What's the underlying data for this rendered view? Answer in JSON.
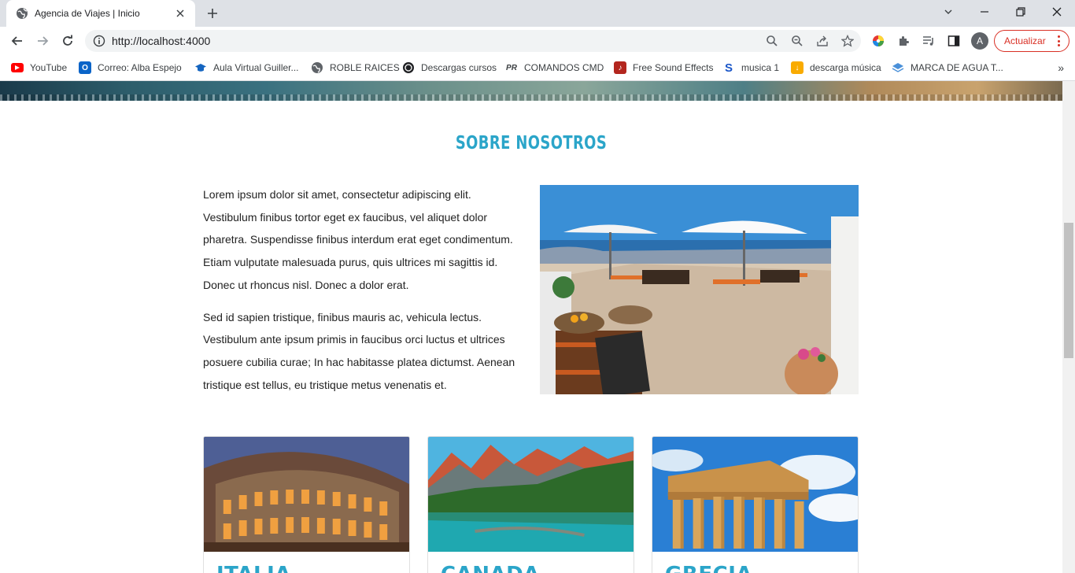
{
  "browser": {
    "tab_title": "Agencia de Viajes | Inicio",
    "url": "http://localhost:4000",
    "update_label": "Actualizar",
    "avatar_initial": "A",
    "bookmarks": [
      {
        "label": "YouTube",
        "icon": "youtube-icon",
        "color": "#ff0000"
      },
      {
        "label": "Correo: Alba Espejo",
        "icon": "outlook-icon",
        "color": "#0a64c8"
      },
      {
        "label": "Aula Virtual Guiller...",
        "icon": "graduation-cap-icon",
        "color": "#1565c0"
      },
      {
        "label": "ROBLE RAICES",
        "icon": "globe-icon",
        "color": "#5f6368"
      },
      {
        "label": "Descargas cursos",
        "icon": "download-circle-icon",
        "color": "#202124"
      },
      {
        "label": "COMANDOS CMD",
        "icon": "pr-icon",
        "color": "#3c4043"
      },
      {
        "label": "Free Sound Effects",
        "icon": "sound-icon",
        "color": "#b3261e"
      },
      {
        "label": "musica 1",
        "icon": "s-icon",
        "color": "#1a56c8"
      },
      {
        "label": "descarga música",
        "icon": "music-download-icon",
        "color": "#f9ab00"
      },
      {
        "label": "MARCA DE AGUA T...",
        "icon": "layers-icon",
        "color": "#4a90d9"
      }
    ]
  },
  "page": {
    "section_title": "SOBRE NOSOTROS",
    "paragraphs": [
      "Lorem ipsum dolor sit amet, consectetur adipiscing elit. Vestibulum finibus tortor eget ex faucibus, vel aliquet dolor pharetra. Suspendisse finibus interdum erat eget condimentum. Etiam vulputate malesuada purus, quis ultrices mi sagittis id. Donec ut rhoncus nisl. Donec a dolor erat.",
      "Sed id sapien tristique, finibus mauris ac, vehicula lectus. Vestibulum ante ipsum primis in faucibus orci luctus et ultrices posuere cubilia curae; In hac habitasse platea dictumst. Aenean tristique est tellus, eu tristique metus venenatis et."
    ],
    "cards": [
      {
        "name": "ITALIA"
      },
      {
        "name": "CANADA"
      },
      {
        "name": "GRECIA"
      }
    ],
    "accent_color": "#2ba5c9"
  }
}
